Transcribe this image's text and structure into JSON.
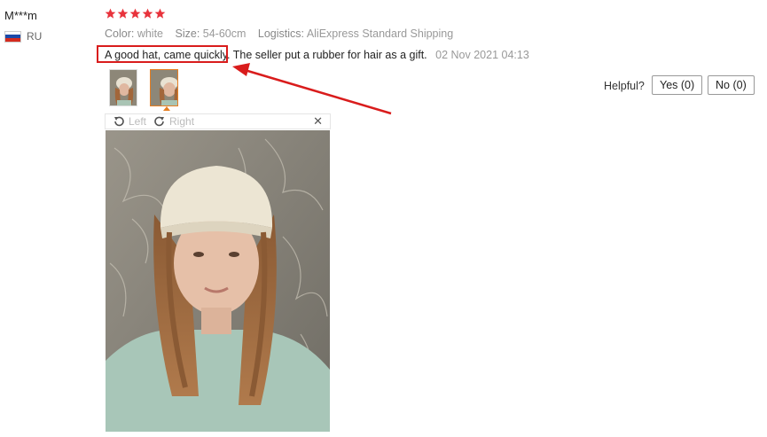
{
  "reviewer": {
    "name": "M***m",
    "country": "RU",
    "flag_colors": [
      "#ffffff",
      "#1c4aa8",
      "#d52b1e"
    ]
  },
  "rating": {
    "stars": 5,
    "max": 5,
    "color": "#e8333c"
  },
  "attributes": [
    {
      "key": "Color:",
      "value": "white"
    },
    {
      "key": "Size:",
      "value": "54-60cm"
    },
    {
      "key": "Logistics:",
      "value": "AliExpress Standard Shipping"
    }
  ],
  "review": {
    "highlighted": "A good hat, came quickly.",
    "rest": "The seller put a rubber for hair as a gift.",
    "date": "02 Nov 2021 04:13"
  },
  "viewer": {
    "left_label": "Left",
    "right_label": "Right",
    "close_icon": "close-icon"
  },
  "helpful": {
    "label": "Helpful?",
    "yes_label": "Yes (0)",
    "no_label": "No (0)"
  },
  "colors": {
    "highlight": "#d91c1c",
    "selected_thumb": "#e67e22"
  }
}
